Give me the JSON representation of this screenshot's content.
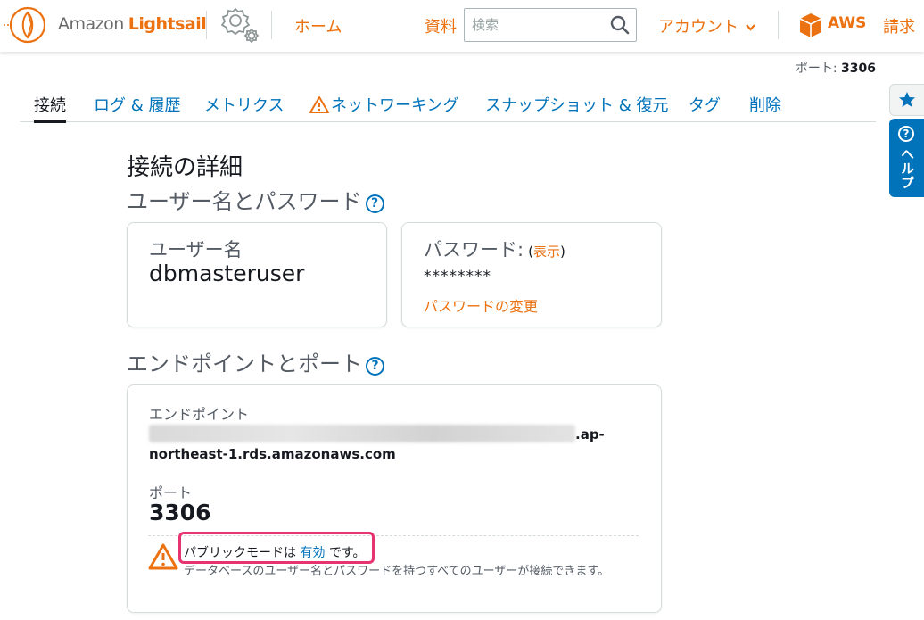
{
  "header": {
    "brand_prefix": "Amazon",
    "brand_name": "Lightsail",
    "home": "ホーム",
    "docs": "資料",
    "search_placeholder": "検索",
    "account": "アカウント",
    "aws": "AWS",
    "billing": "請求"
  },
  "port_summary": {
    "label": "ポート:",
    "value": "3306"
  },
  "tabs": [
    {
      "label": "接続",
      "active": true
    },
    {
      "label": "ログ & 履歴"
    },
    {
      "label": "メトリクス"
    },
    {
      "label": "ネットワーキング",
      "warning": true
    },
    {
      "label": "スナップショット & 復元"
    },
    {
      "label": "タグ"
    },
    {
      "label": "削除"
    }
  ],
  "connection": {
    "title": "接続の詳細",
    "credentials_heading": "ユーザー名とパスワード",
    "username_label": "ユーザー名",
    "username_value": "dbmasteruser",
    "password_label": "パスワード:",
    "password_show_open": "(",
    "password_show": "表示",
    "password_show_close": ")",
    "password_masked": "********",
    "password_change": "パスワードの変更",
    "endpoint_heading": "エンドポイントとポート",
    "endpoint_label": "エンドポイント",
    "endpoint_suffix_1": ".ap-",
    "endpoint_suffix_2": "northeast-1.rds.amazonaws.com",
    "port_label": "ポート",
    "port_value": "3306",
    "public_mode_prefix": "パブリックモードは",
    "public_mode_state": "有効",
    "public_mode_suffix": "です。",
    "public_mode_desc": "データベースのユーザー名とパスワードを持つすべてのユーザーが接続できます。"
  },
  "side": {
    "help_label": "ヘルプ",
    "help_q": "?"
  },
  "help_q": "?"
}
